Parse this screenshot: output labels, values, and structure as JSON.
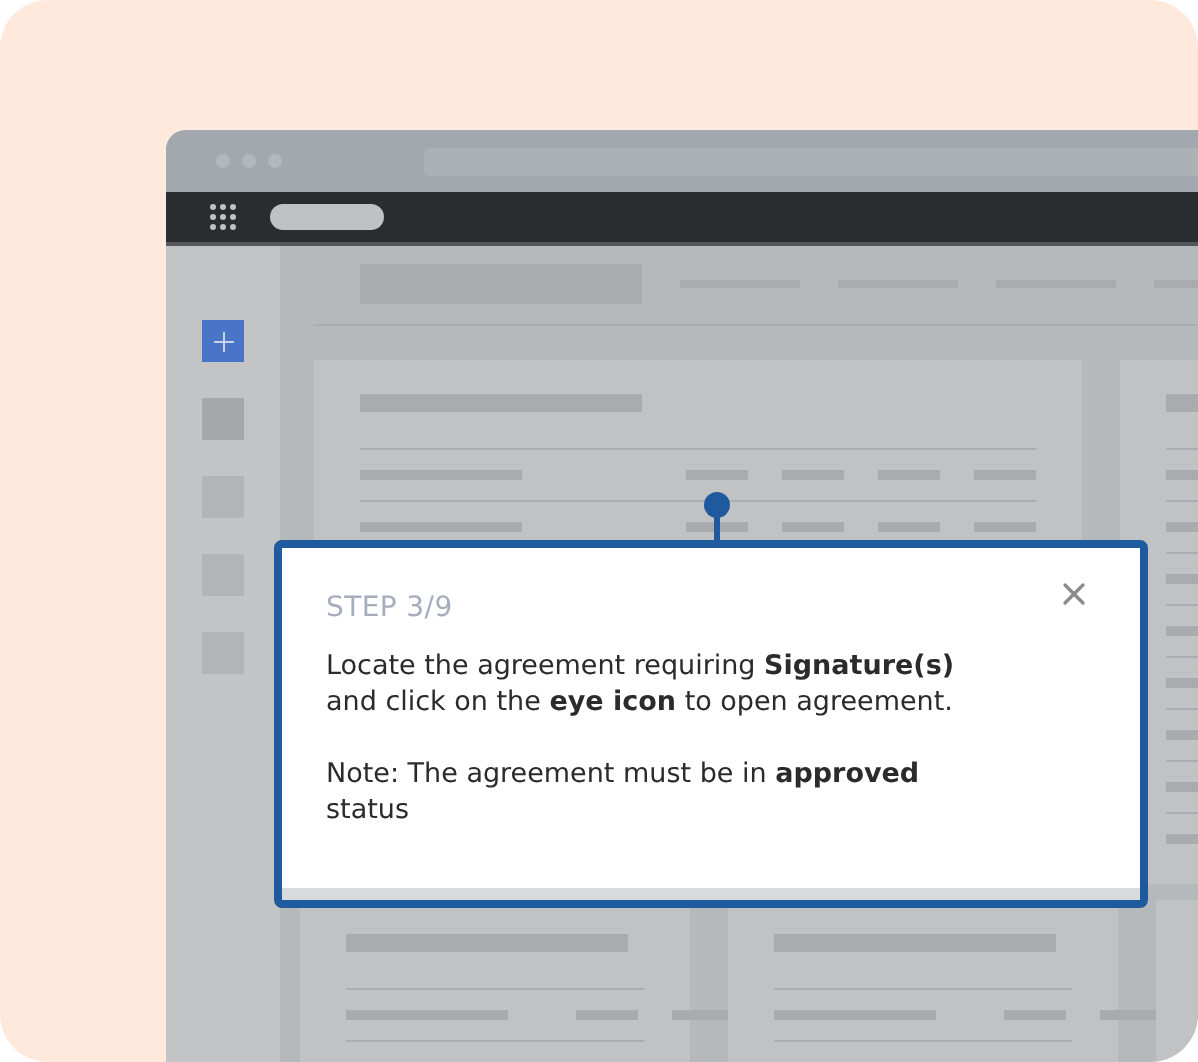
{
  "tooltip": {
    "step": "STEP 3/9",
    "paragraphs": [
      "Locate the agreement requiring **Signature(s)** and click on the **eye icon** to open agreement.",
      "Note: The agreement must be in **approved** status"
    ]
  }
}
